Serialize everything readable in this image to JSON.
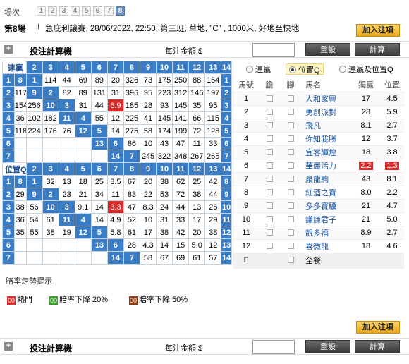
{
  "race_selector": {
    "label": "場次",
    "races": [
      "1",
      "2",
      "3",
      "4",
      "5",
      "6",
      "7",
      "8"
    ],
    "active": "8"
  },
  "race_info": {
    "race_title": "第8場",
    "separator": "I",
    "description": "急庇利讓賽, 28/06/2022, 22:50, 第三班, 草地, \"C\" , 1000米, 好地至快地",
    "add_button": "加入注項"
  },
  "calculator": {
    "title": "投注計算機",
    "amount_label": "每注金額 $",
    "reset": "重設",
    "calc": "計算"
  },
  "quinella": {
    "title": "連贏",
    "header": [
      "2",
      "3",
      "4",
      "5",
      "6",
      "7",
      "8",
      "9",
      "10",
      "11",
      "12",
      "13",
      "14"
    ],
    "row_labels": [
      "1",
      "2",
      "3",
      "4",
      "5",
      "6",
      "7",
      "8",
      "9",
      "10",
      "11",
      "12",
      "13",
      "14"
    ],
    "rows": [
      [
        "8",
        "1",
        "114",
        "44",
        "69",
        "89",
        "20",
        "326",
        "73",
        "175",
        "250",
        "88",
        "164"
      ],
      [
        "117",
        "9",
        "2",
        "82",
        "89",
        "131",
        "31",
        "396",
        "95",
        "223",
        "312",
        "146",
        "197"
      ],
      [
        "154",
        "256",
        "10",
        "3",
        "31",
        "44",
        "6.9",
        "185",
        "28",
        "93",
        "145",
        "35",
        "95"
      ],
      [
        "36",
        "102",
        "182",
        "11",
        "4",
        "55",
        "12",
        "225",
        "41",
        "145",
        "141",
        "66",
        "115"
      ],
      [
        "118",
        "224",
        "176",
        "76",
        "12",
        "5",
        "14",
        "275",
        "58",
        "174",
        "199",
        "72",
        "128"
      ],
      [
        "",
        "",
        "",
        "",
        "",
        "13",
        "6",
        "86",
        "10",
        "43",
        "47",
        "11",
        "33"
      ],
      [
        "",
        "",
        "",
        "",
        "",
        "",
        "14",
        "7",
        "245",
        "322",
        "348",
        "267",
        "265"
      ]
    ],
    "right_labels": [
      "1",
      "2",
      "3",
      "4",
      "5",
      "6",
      "7"
    ],
    "red": [
      [
        2,
        6
      ]
    ]
  },
  "place_q": {
    "title": "位置Q",
    "header": [
      "2",
      "3",
      "4",
      "5",
      "6",
      "7",
      "8",
      "9",
      "10",
      "11",
      "12",
      "13",
      "14"
    ],
    "rows": [
      [
        "8",
        "1",
        "32",
        "13",
        "18",
        "25",
        "8.5",
        "67",
        "20",
        "38",
        "62",
        "25",
        "42"
      ],
      [
        "29",
        "9",
        "2",
        "23",
        "21",
        "34",
        "11",
        "83",
        "22",
        "53",
        "72",
        "38",
        "44"
      ],
      [
        "38",
        "56",
        "10",
        "3",
        "9.1",
        "14",
        "3.3",
        "47",
        "8.3",
        "24",
        "44",
        "13",
        "26"
      ],
      [
        "36",
        "54",
        "61",
        "11",
        "4",
        "14",
        "4.9",
        "52",
        "10",
        "31",
        "33",
        "17",
        "29"
      ],
      [
        "35",
        "55",
        "38",
        "19",
        "12",
        "5",
        "5.8",
        "61",
        "17",
        "38",
        "42",
        "20",
        "38"
      ],
      [
        "",
        "",
        "",
        "",
        "",
        "13",
        "6",
        "28",
        "4.3",
        "14",
        "15",
        "5.0",
        "12"
      ],
      [
        "",
        "",
        "",
        "",
        "",
        "",
        "14",
        "7",
        "58",
        "67",
        "69",
        "61",
        "57"
      ]
    ],
    "right_labels": [
      "8",
      "9",
      "10",
      "11",
      "12",
      "13",
      "14"
    ],
    "red": [
      [
        2,
        6
      ]
    ]
  },
  "tabs": {
    "quinella": "連贏",
    "place_q": "位置Q",
    "both": "連贏及位置Q",
    "active": "place_q"
  },
  "horse_table": {
    "headers": [
      "馬號",
      "膽",
      "腳",
      "馬名",
      "獨贏",
      "位置"
    ],
    "horses": [
      {
        "no": "1",
        "name": "人和家興",
        "win": "17",
        "place": "4.5"
      },
      {
        "no": "2",
        "name": "勇創派對",
        "win": "28",
        "place": "5.9"
      },
      {
        "no": "3",
        "name": "飛凡",
        "win": "8.1",
        "place": "2.7"
      },
      {
        "no": "4",
        "name": "你知我勝",
        "win": "12",
        "place": "3.7"
      },
      {
        "no": "5",
        "name": "宜客輝煌",
        "win": "18",
        "place": "3.8"
      },
      {
        "no": "6",
        "name": "華麗活力",
        "win": "2.2",
        "place": "1.3",
        "hot": true
      },
      {
        "no": "7",
        "name": "泉龍駒",
        "win": "43",
        "place": "8.1"
      },
      {
        "no": "8",
        "name": "紅酒之寶",
        "win": "8.0",
        "place": "2.2"
      },
      {
        "no": "9",
        "name": "多多寶驥",
        "win": "21",
        "place": "4.7"
      },
      {
        "no": "10",
        "name": "謙謙君子",
        "win": "21",
        "place": "5.0"
      },
      {
        "no": "11",
        "name": "靚多福",
        "win": "8.9",
        "place": "2.7"
      },
      {
        "no": "12",
        "name": "喜微龍",
        "win": "18",
        "place": "4.6"
      }
    ],
    "field_label": "F",
    "all_label": "全餐"
  },
  "trend": {
    "title": "賠率走勢提示",
    "items": [
      {
        "code": "00",
        "label": "熱門",
        "color": "#d92b2b"
      },
      {
        "code": "00",
        "label": "賠率下降 20%",
        "color": "#3a9d2c"
      },
      {
        "code": "00",
        "label": "賠率下降 50%",
        "color": "#8b3a10"
      }
    ]
  }
}
